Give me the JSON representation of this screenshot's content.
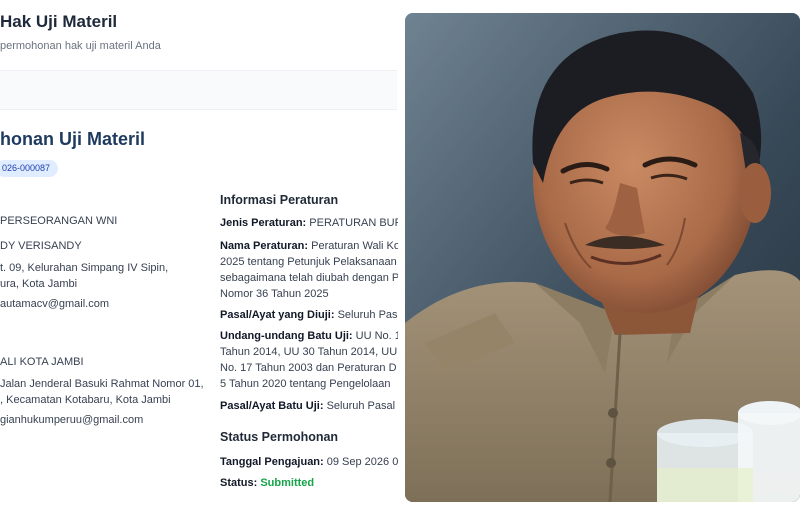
{
  "header": {
    "title": "Hak Uji Materil",
    "subtitle": "permohonan hak uji materil Anda"
  },
  "card": {
    "title": "honan Uji Materil",
    "reg_number": "026-000087"
  },
  "applicant": {
    "type": "PERSEORANGAN WNI",
    "name": "DY VERISANDY",
    "address_1": "t. 09, Kelurahan Simpang IV Sipin,",
    "address_2": "ura, Kota Jambi",
    "email": "autamacv@gmail.com"
  },
  "respondent": {
    "name": "ALI KOTA JAMBI",
    "address_1": "Jalan Jenderal Basuki Rahmat Nomor 01,",
    "address_2": ", Kecamatan Kotabaru, Kota Jambi",
    "email": "gianhukumperuu@gmail.com"
  },
  "regulation": {
    "section_title": "Informasi Peraturan",
    "type_label": "Jenis Peraturan:",
    "type_value": "PERATURAN BUPA",
    "name_label": "Nama Peraturan:",
    "name_value_1": "Peraturan Wali Ko",
    "name_value_2": "2025 tentang Petunjuk Pelaksanaan",
    "name_value_3": "sebagaimana telah diubah dengan P",
    "name_value_4": "Nomor 36 Tahun 2025",
    "article_label": "Pasal/Ayat yang Diuji:",
    "article_value": "Seluruh Pasal",
    "law_label": "Undang-undang Batu Uji:",
    "law_value_1": "UU No. 1",
    "law_value_2": "Tahun 2014, UU 30 Tahun 2014, UU",
    "law_value_3": "No. 17 Tahun 2003 dan Peraturan D",
    "law_value_4": "5 Tahun 2020 tentang Pengelolaan",
    "test_article_label": "Pasal/Ayat Batu Uji:",
    "test_article_value": "Seluruh Pasal"
  },
  "status": {
    "section_title": "Status Permohonan",
    "date_label": "Tanggal Pengajuan:",
    "date_value": "09 Sep 2026 0",
    "status_label": "Status:",
    "status_value": "Submitted"
  },
  "photo": {
    "description_icon": "person-photo"
  }
}
